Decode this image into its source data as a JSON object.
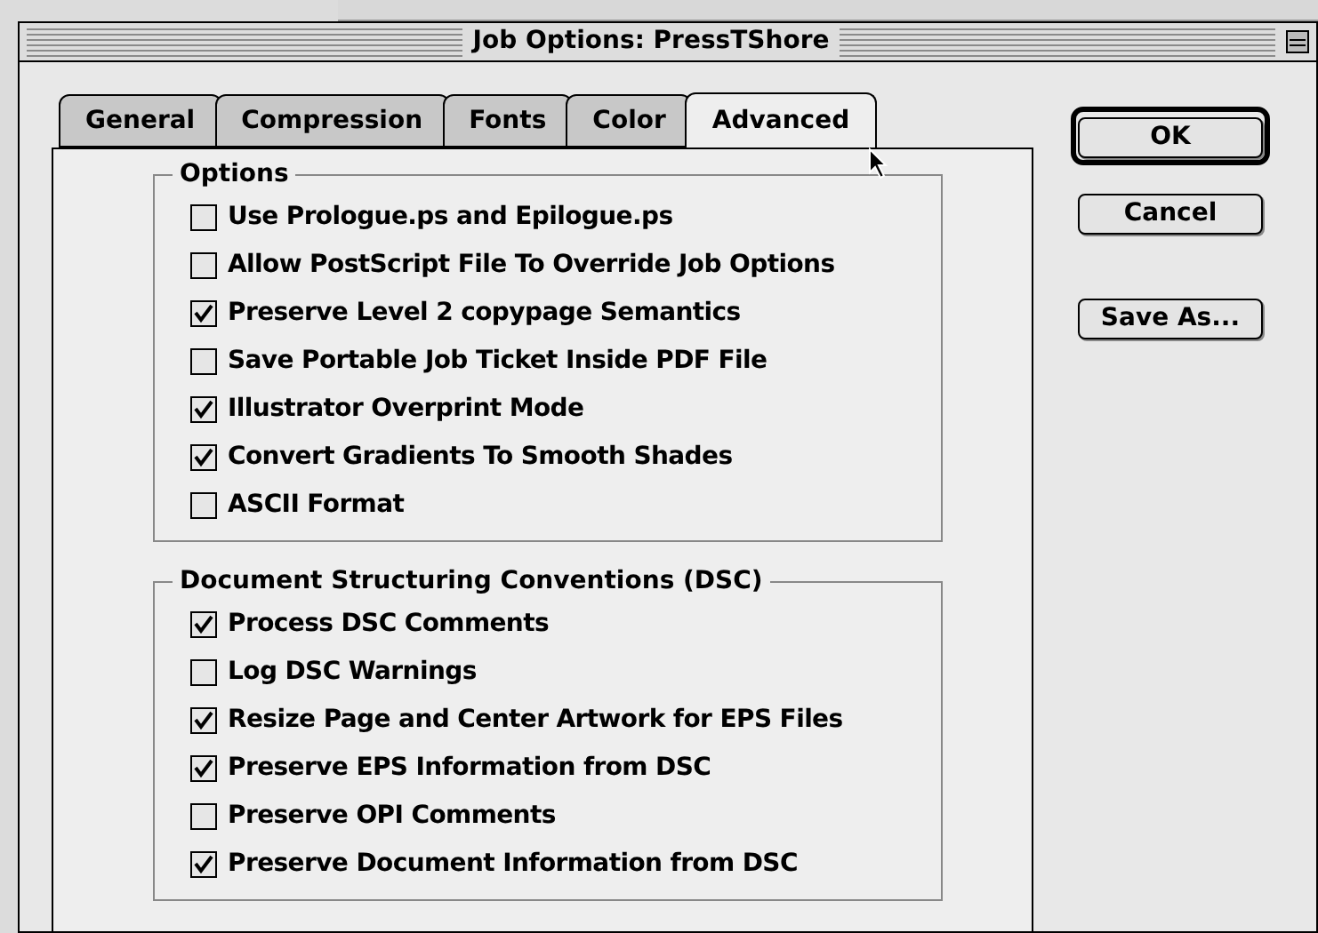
{
  "window": {
    "title": "Job Options: PressTShore"
  },
  "tabs": [
    {
      "label": "General",
      "selected": false
    },
    {
      "label": "Compression",
      "selected": false
    },
    {
      "label": "Fonts",
      "selected": false
    },
    {
      "label": "Color",
      "selected": false
    },
    {
      "label": "Advanced",
      "selected": true
    }
  ],
  "groups": [
    {
      "title": "Options",
      "items": [
        {
          "label": "Use Prologue.ps and Epilogue.ps",
          "checked": false
        },
        {
          "label": "Allow PostScript File To Override Job Options",
          "checked": false
        },
        {
          "label": "Preserve Level 2 copypage Semantics",
          "checked": true
        },
        {
          "label": "Save Portable Job Ticket Inside PDF File",
          "checked": false
        },
        {
          "label": "Illustrator Overprint Mode",
          "checked": true
        },
        {
          "label": "Convert Gradients To Smooth Shades",
          "checked": true
        },
        {
          "label": "ASCII Format",
          "checked": false
        }
      ]
    },
    {
      "title": "Document Structuring Conventions (DSC)",
      "items": [
        {
          "label": "Process DSC Comments",
          "checked": true
        },
        {
          "label": "Log DSC Warnings",
          "checked": false
        },
        {
          "label": "Resize Page and Center Artwork for EPS Files",
          "checked": true
        },
        {
          "label": "Preserve EPS Information from DSC",
          "checked": true
        },
        {
          "label": "Preserve OPI Comments",
          "checked": false
        },
        {
          "label": "Preserve Document Information from DSC",
          "checked": true
        }
      ]
    }
  ],
  "buttons": [
    {
      "label": "OK",
      "default": true
    },
    {
      "label": "Cancel",
      "default": false
    },
    {
      "label": "Save As...",
      "default": false
    }
  ]
}
